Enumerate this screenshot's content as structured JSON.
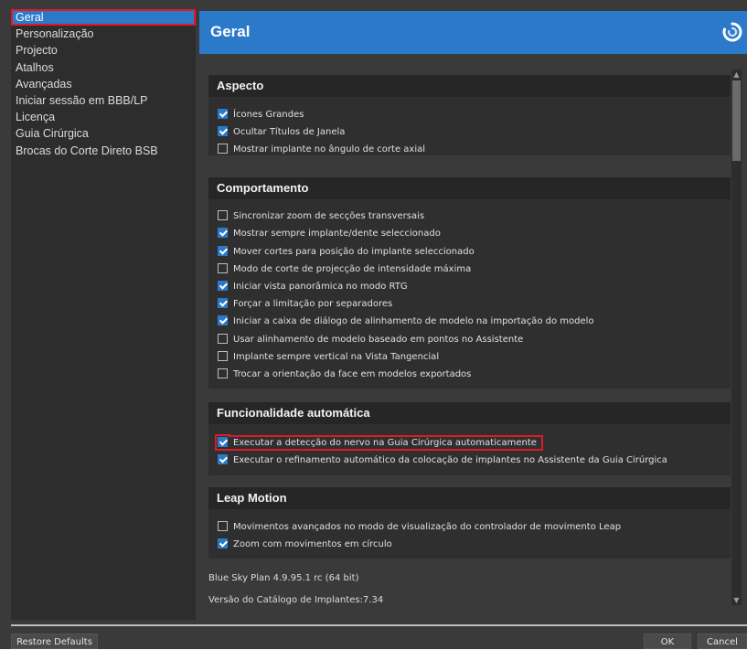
{
  "sidebar": {
    "items": [
      {
        "label": "Geral",
        "selected": true
      },
      {
        "label": "Personalização"
      },
      {
        "label": "Projecto"
      },
      {
        "label": "Atalhos"
      },
      {
        "label": "Avançadas"
      },
      {
        "label": "Iniciar sessão em BBB/LP"
      },
      {
        "label": "Licença"
      },
      {
        "label": "Guia Cirúrgica"
      },
      {
        "label": "Brocas do Corte Direto BSB"
      }
    ]
  },
  "header": {
    "title": "Geral",
    "logo_icon": "refresh-swirl-icon"
  },
  "sections": {
    "aspecto": {
      "title": "Aspecto",
      "options": [
        {
          "label": "Ícones Grandes",
          "checked": true
        },
        {
          "label": "Ocultar Títulos de Janela",
          "checked": true
        },
        {
          "label": "Mostrar implante no ângulo de corte axial",
          "checked": false
        }
      ]
    },
    "comportamento": {
      "title": "Comportamento",
      "options": [
        {
          "label": "Sincronizar zoom de secções transversais",
          "checked": false
        },
        {
          "label": "Mostrar sempre implante/dente seleccionado",
          "checked": true
        },
        {
          "label": "Mover cortes para posição do implante seleccionado",
          "checked": true
        },
        {
          "label": "Modo de corte de projecção de intensidade máxima",
          "checked": false
        },
        {
          "label": "Iniciar vista panorâmica no modo RTG",
          "checked": true
        },
        {
          "label": "Forçar a limitação por separadores",
          "checked": true
        },
        {
          "label": "Iniciar a caixa de diálogo de alinhamento de modelo na importação do modelo",
          "checked": true
        },
        {
          "label": "Usar alinhamento de modelo baseado em pontos no Assistente",
          "checked": false
        },
        {
          "label": "Implante sempre vertical na Vista Tangencial",
          "checked": false
        },
        {
          "label": "Trocar a orientação da face em modelos exportados",
          "checked": false
        }
      ]
    },
    "funcionalidade": {
      "title": "Funcionalidade automática",
      "options": [
        {
          "label": "Executar a detecção do nervo na Guia Cirúrgica automaticamente",
          "checked": true
        },
        {
          "label": "Executar o refinamento automático da colocação de implantes no Assistente da Guia Cirúrgica",
          "checked": true
        }
      ]
    },
    "leap": {
      "title": "Leap Motion",
      "options": [
        {
          "label": "Movimentos avançados no modo de visualização do controlador de movimento Leap",
          "checked": false
        },
        {
          "label": "Zoom com movimentos em círculo",
          "checked": true
        }
      ]
    }
  },
  "info": {
    "version": "Blue Sky Plan 4.9.95.1 rc (64 bit)",
    "catalog": "Versão do Catálogo de Implantes:7.34"
  },
  "footer": {
    "restore_label": "Restore Defaults",
    "ok_label": "OK",
    "cancel_label": "Cancel"
  },
  "colors": {
    "accent": "#2b79c9",
    "highlight": "#e0192a",
    "background": "#3a3a3a",
    "panel": "#2f2f2f"
  }
}
